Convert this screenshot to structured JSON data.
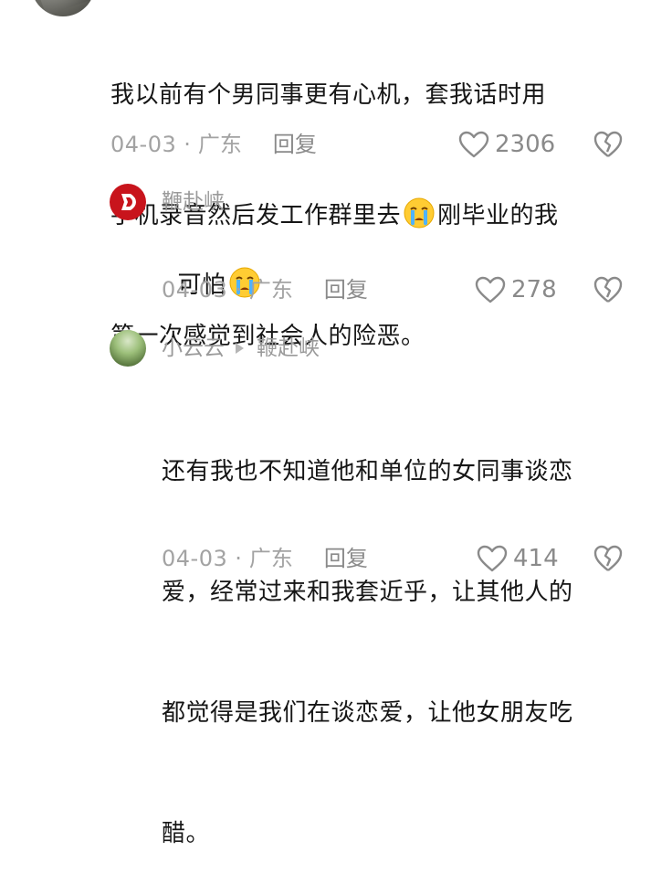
{
  "comments": [
    {
      "lines": [
        "我以前有个男同事更有心机，套我话时用",
        "手机录音然后发工作群里去",
        "刚毕业的我",
        "第一次感觉到社会人的险恶。"
      ],
      "date": "04-03",
      "location": "广东",
      "reply_label": "回复",
      "likes": "2306",
      "emoji": "crying-face"
    }
  ],
  "replies": [
    {
      "username": "鞭赴峡",
      "text": "可怕",
      "emoji": "crying-face",
      "date": "04-03",
      "location": "广东",
      "reply_label": "回复",
      "likes": "278",
      "avatar_color": "#c8141c"
    },
    {
      "username": "小云云",
      "reply_to": "鞭赴峡",
      "lines": [
        "还有我也不知道他和单位的女同事谈恋",
        "爱，经常过来和我套近乎，让其他人的",
        "都觉得是我们在谈恋爱，让他女朋友吃",
        "醋。"
      ],
      "date": "04-03",
      "location": "广东",
      "reply_label": "回复",
      "likes": "414"
    }
  ],
  "separator": "·",
  "icons": {
    "like": "heart-outline-icon",
    "dislike": "broken-heart-icon",
    "play": "triangle-right-icon"
  },
  "colors": {
    "meta_gray": "#a3a3a3",
    "text": "#161616",
    "avatar_red": "#c8141c"
  }
}
